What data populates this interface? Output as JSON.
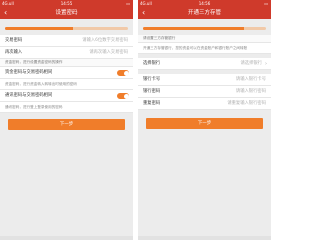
{
  "left": {
    "status": {
      "carrier": "4G.ull",
      "time": "14:55",
      "battery": "▭"
    },
    "nav": {
      "back": "‹",
      "title": "设置密码"
    },
    "progress_fraction": 0.55,
    "rows": [
      {
        "label": "交易密码",
        "placeholder": "请输入6位数字交易密码"
      },
      {
        "label": "再次输入",
        "placeholder": "请再次输入交易密码"
      }
    ],
    "note1": "资金密码，进行设置资金密码的操作",
    "toggle1": {
      "label": "资金密码与交易密码相同",
      "on": true
    },
    "para1": "资金密码，进行资金转入转转出时使用的密码",
    "toggle2": {
      "label": "通讯密码与交易密码相同",
      "on": true
    },
    "para2": "通讯密码，进行登上登录使用的密码",
    "button": "下一步"
  },
  "right": {
    "status": {
      "carrier": "4G.ull",
      "time": "14:56",
      "battery": "▭"
    },
    "nav": {
      "back": "‹",
      "title": "开通三方存管"
    },
    "progress_fraction": 0.82,
    "note1": "请设置三方存管银行",
    "para1": "开通三方存管银行，您的资金可以在资金账户和银行账户之间转账",
    "bank_row": {
      "label": "选择银行",
      "placeholder": "请选择银行",
      "chevron": "›"
    },
    "rows": [
      {
        "label": "银行卡号",
        "placeholder": "请输入银行卡号"
      },
      {
        "label": "银行密码",
        "placeholder": "请输入银行密码"
      },
      {
        "label": "重复密码",
        "placeholder": "请重复输入银行密码"
      }
    ],
    "button": "下一步"
  }
}
